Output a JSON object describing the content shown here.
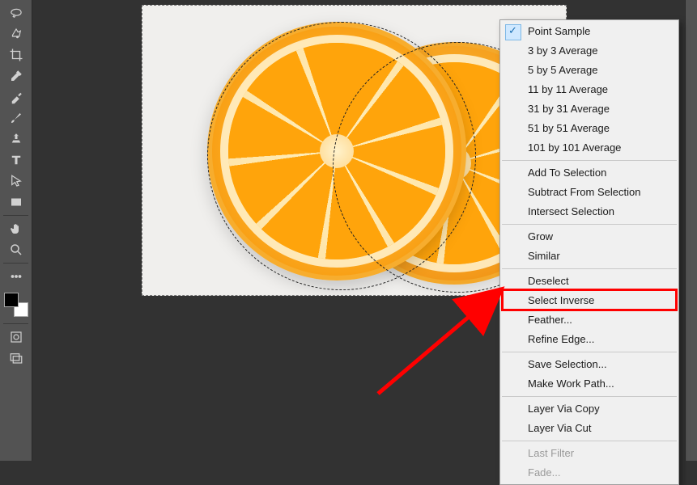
{
  "tools": [
    {
      "name": "lasso-tool"
    },
    {
      "name": "quick-selection-tool"
    },
    {
      "name": "crop-tool"
    },
    {
      "name": "eyedropper-tool"
    },
    {
      "name": "spot-healing-tool"
    },
    {
      "name": "brush-tool"
    },
    {
      "name": "clone-stamp-tool"
    },
    {
      "name": "type-tool"
    },
    {
      "name": "path-selection-tool"
    },
    {
      "name": "rectangle-tool"
    },
    {
      "name": "hand-tool"
    },
    {
      "name": "zoom-tool"
    }
  ],
  "context_menu": {
    "groups": [
      [
        {
          "label": "Point Sample",
          "checked": true
        },
        {
          "label": "3 by 3 Average"
        },
        {
          "label": "5 by 5 Average"
        },
        {
          "label": "11 by 11 Average"
        },
        {
          "label": "31 by 31 Average"
        },
        {
          "label": "51 by 51 Average"
        },
        {
          "label": "101 by 101 Average"
        }
      ],
      [
        {
          "label": "Add To Selection"
        },
        {
          "label": "Subtract From Selection"
        },
        {
          "label": "Intersect Selection"
        }
      ],
      [
        {
          "label": "Grow"
        },
        {
          "label": "Similar"
        }
      ],
      [
        {
          "label": "Deselect"
        },
        {
          "label": "Select Inverse",
          "highlighted": true
        },
        {
          "label": "Feather..."
        },
        {
          "label": "Refine Edge..."
        }
      ],
      [
        {
          "label": "Save Selection..."
        },
        {
          "label": "Make Work Path..."
        }
      ],
      [
        {
          "label": "Layer Via Copy"
        },
        {
          "label": "Layer Via Cut"
        }
      ],
      [
        {
          "label": "Last Filter",
          "disabled": true
        },
        {
          "label": "Fade...",
          "disabled": true
        }
      ]
    ]
  },
  "annotation": {
    "highlight_target": "Select Inverse",
    "highlight_color": "#ff0000"
  },
  "canvas": {
    "subject": "orange-slices",
    "selection": "subject"
  }
}
